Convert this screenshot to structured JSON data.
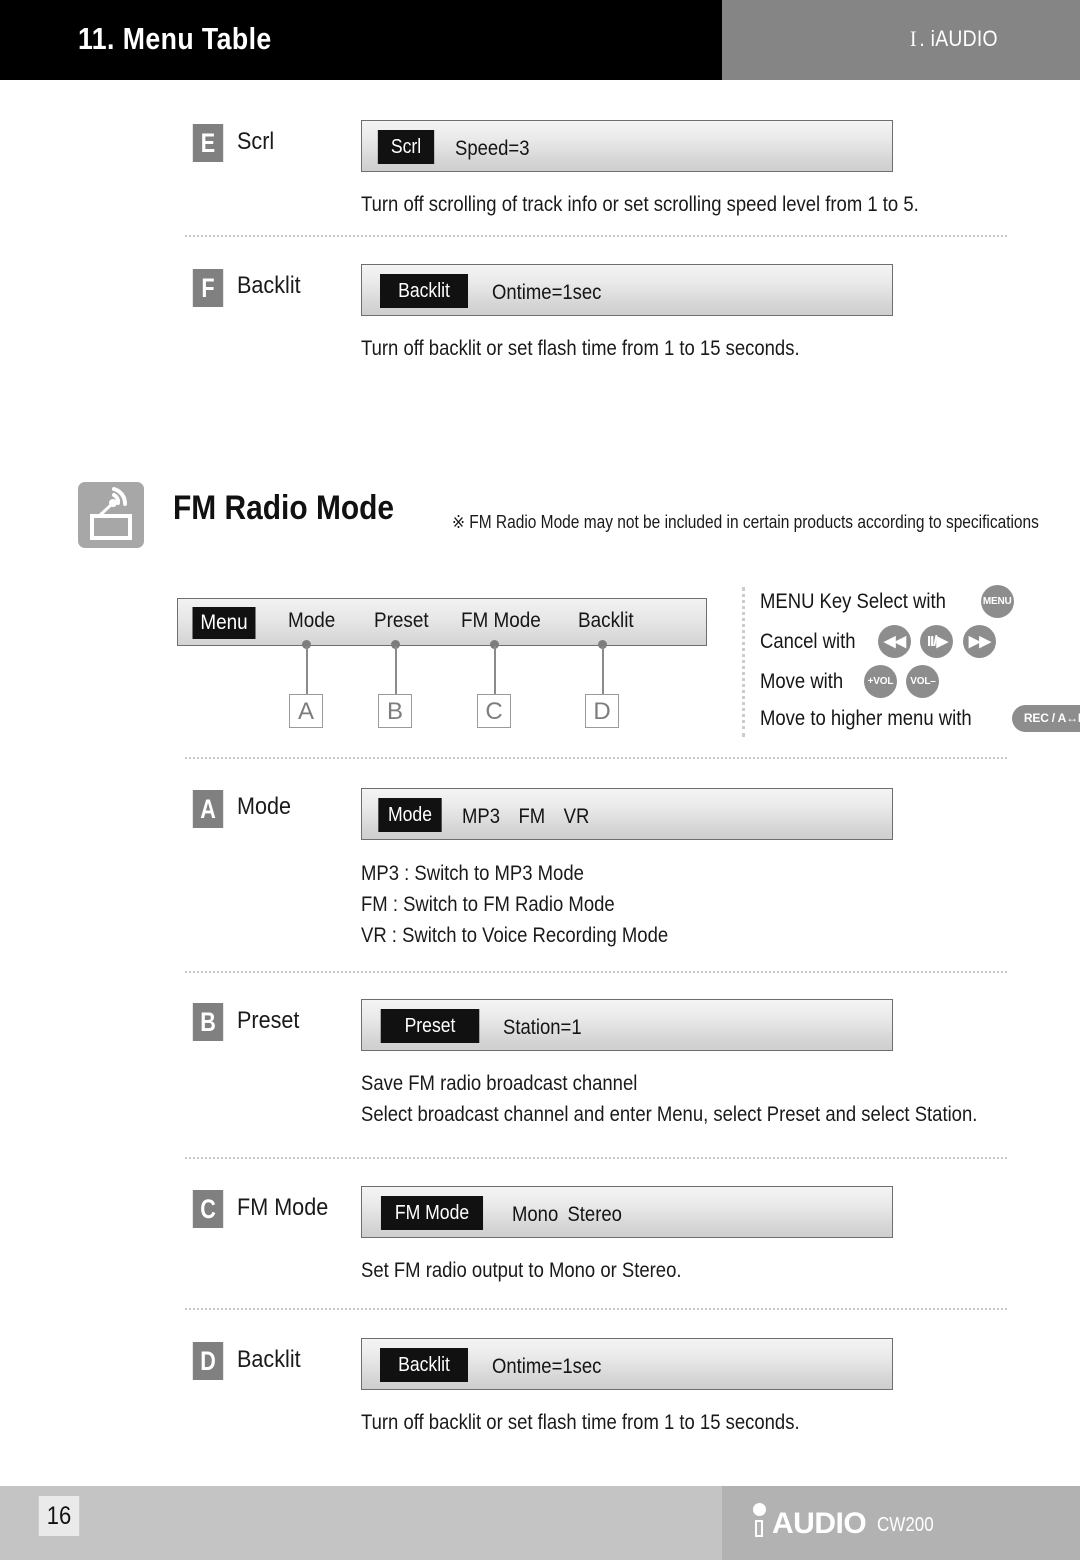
{
  "header": {
    "title": "11. Menu Table",
    "chapter_num": "I",
    "chapter_sep": ".",
    "chapter_label": "iAUDIO"
  },
  "top_items": [
    {
      "badge": "E",
      "title": "Scrl",
      "lcd_tag": "Scrl",
      "lcd_value": "Speed=3",
      "desc": [
        "Turn off scrolling of track info or set scrolling speed level from 1 to 5."
      ]
    },
    {
      "badge": "F",
      "title": "Backlit",
      "lcd_tag": "Backlit",
      "lcd_value": "Ontime=1sec",
      "desc": [
        "Turn off backlit or set flash time from 1 to 15 seconds."
      ]
    }
  ],
  "section": {
    "icon": "fm-radio-icon",
    "title": "FM Radio Mode",
    "note": "※ FM Radio Mode may not be included in certain products according to specifications"
  },
  "navbar": {
    "menu_tag": "Menu",
    "labels": [
      "Mode",
      "Preset",
      "FM Mode",
      "Backlit"
    ],
    "callouts": [
      "A",
      "B",
      "C",
      "D"
    ]
  },
  "legend": {
    "rows": [
      {
        "text": "MENU Key Select with",
        "keys": [
          {
            "type": "circle",
            "label": "MENU",
            "icon_name": "menu-key-icon"
          }
        ]
      },
      {
        "text": "Cancel with",
        "keys": [
          {
            "type": "circle-glyph",
            "label": "◀◀",
            "icon_name": "rewind-key-icon"
          },
          {
            "type": "circle-glyph",
            "label": "II/▶",
            "icon_name": "play-pause-key-icon"
          },
          {
            "type": "circle-glyph",
            "label": "▶▶",
            "icon_name": "fast-forward-key-icon"
          }
        ]
      },
      {
        "text": "Move with",
        "keys": [
          {
            "type": "circle",
            "label": "+VOL",
            "icon_name": "volume-up-key-icon"
          },
          {
            "type": "circle",
            "label": "VOL–",
            "icon_name": "volume-down-key-icon"
          }
        ]
      },
      {
        "text": "Move to higher menu with",
        "keys": [
          {
            "type": "pill",
            "label": "REC / A↔B",
            "icon_name": "rec-ab-key-icon"
          }
        ]
      }
    ]
  },
  "fm_items": [
    {
      "badge": "A",
      "title": "Mode",
      "lcd_tag": "Mode",
      "lcd_value": "MP3 FM VR",
      "desc": [
        "MP3 : Switch to MP3 Mode",
        "FM : Switch to FM Radio Mode",
        "VR : Switch to Voice Recording Mode"
      ]
    },
    {
      "badge": "B",
      "title": "Preset",
      "lcd_tag": "Preset",
      "lcd_value": "Station=1",
      "desc": [
        "Save FM radio broadcast channel",
        "Select broadcast channel and enter Menu, select Preset and select Station."
      ]
    },
    {
      "badge": "C",
      "title": "FM Mode",
      "lcd_tag": "FM Mode",
      "lcd_value": "Mono Stereo",
      "desc": [
        "Set FM radio output to Mono or Stereo."
      ]
    },
    {
      "badge": "D",
      "title": "Backlit",
      "lcd_tag": "Backlit",
      "lcd_value": "Ontime=1sec",
      "desc": [
        "Turn off backlit or set flash time from 1 to 15 seconds."
      ]
    }
  ],
  "footer": {
    "page_number": "16",
    "logo_text": "AUDIO",
    "model": "CW200"
  },
  "colors": {
    "header_black": "#000000",
    "header_gray": "#858585",
    "badge_gray": "#808080",
    "key_gray": "#8d8d8d",
    "footer_left": "#c4c4c4",
    "footer_right": "#b2b2b2",
    "lcd_tag_black": "#111111"
  }
}
